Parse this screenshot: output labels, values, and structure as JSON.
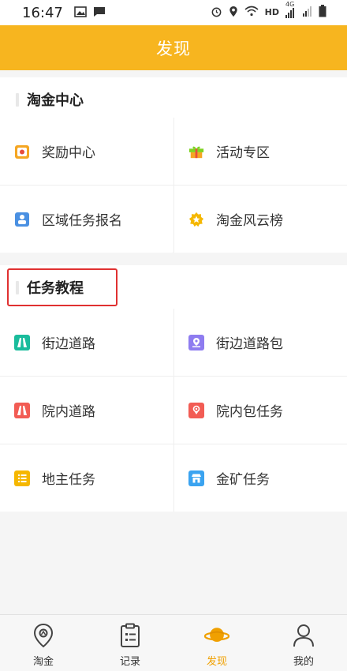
{
  "status_bar": {
    "time": "16:47",
    "network_label": "HD",
    "signal_label": "4G"
  },
  "header": {
    "title": "发现"
  },
  "sections": [
    {
      "title": "淘金中心",
      "items": [
        {
          "label": "奖励中心",
          "icon": "reward-icon",
          "color": "#f5a623"
        },
        {
          "label": "活动专区",
          "icon": "gift-icon",
          "color": "#7ed321"
        },
        {
          "label": "区域任务报名",
          "icon": "signup-icon",
          "color": "#4a90e2"
        },
        {
          "label": "淘金风云榜",
          "icon": "star-badge-icon",
          "color": "#f5a623"
        }
      ]
    },
    {
      "title": "任务教程",
      "items": [
        {
          "label": "街边道路",
          "icon": "road-icon",
          "color": "#1abc9c"
        },
        {
          "label": "街边道路包",
          "icon": "map-package-icon",
          "color": "#8e7cf0"
        },
        {
          "label": "院内道路",
          "icon": "road-icon",
          "color": "#f25c54"
        },
        {
          "label": "院内包任务",
          "icon": "location-package-icon",
          "color": "#f25c54"
        },
        {
          "label": "地主任务",
          "icon": "list-icon",
          "color": "#f5b700"
        },
        {
          "label": "金矿任务",
          "icon": "store-icon",
          "color": "#3aa3f0"
        }
      ]
    }
  ],
  "tabs": [
    {
      "label": "淘金",
      "icon": "location-pin-icon",
      "active": false
    },
    {
      "label": "记录",
      "icon": "clipboard-icon",
      "active": false
    },
    {
      "label": "发现",
      "icon": "planet-icon",
      "active": true
    },
    {
      "label": "我的",
      "icon": "user-icon",
      "active": false
    }
  ],
  "colors": {
    "brand": "#f7b51f",
    "highlight_border": "#e03131"
  }
}
